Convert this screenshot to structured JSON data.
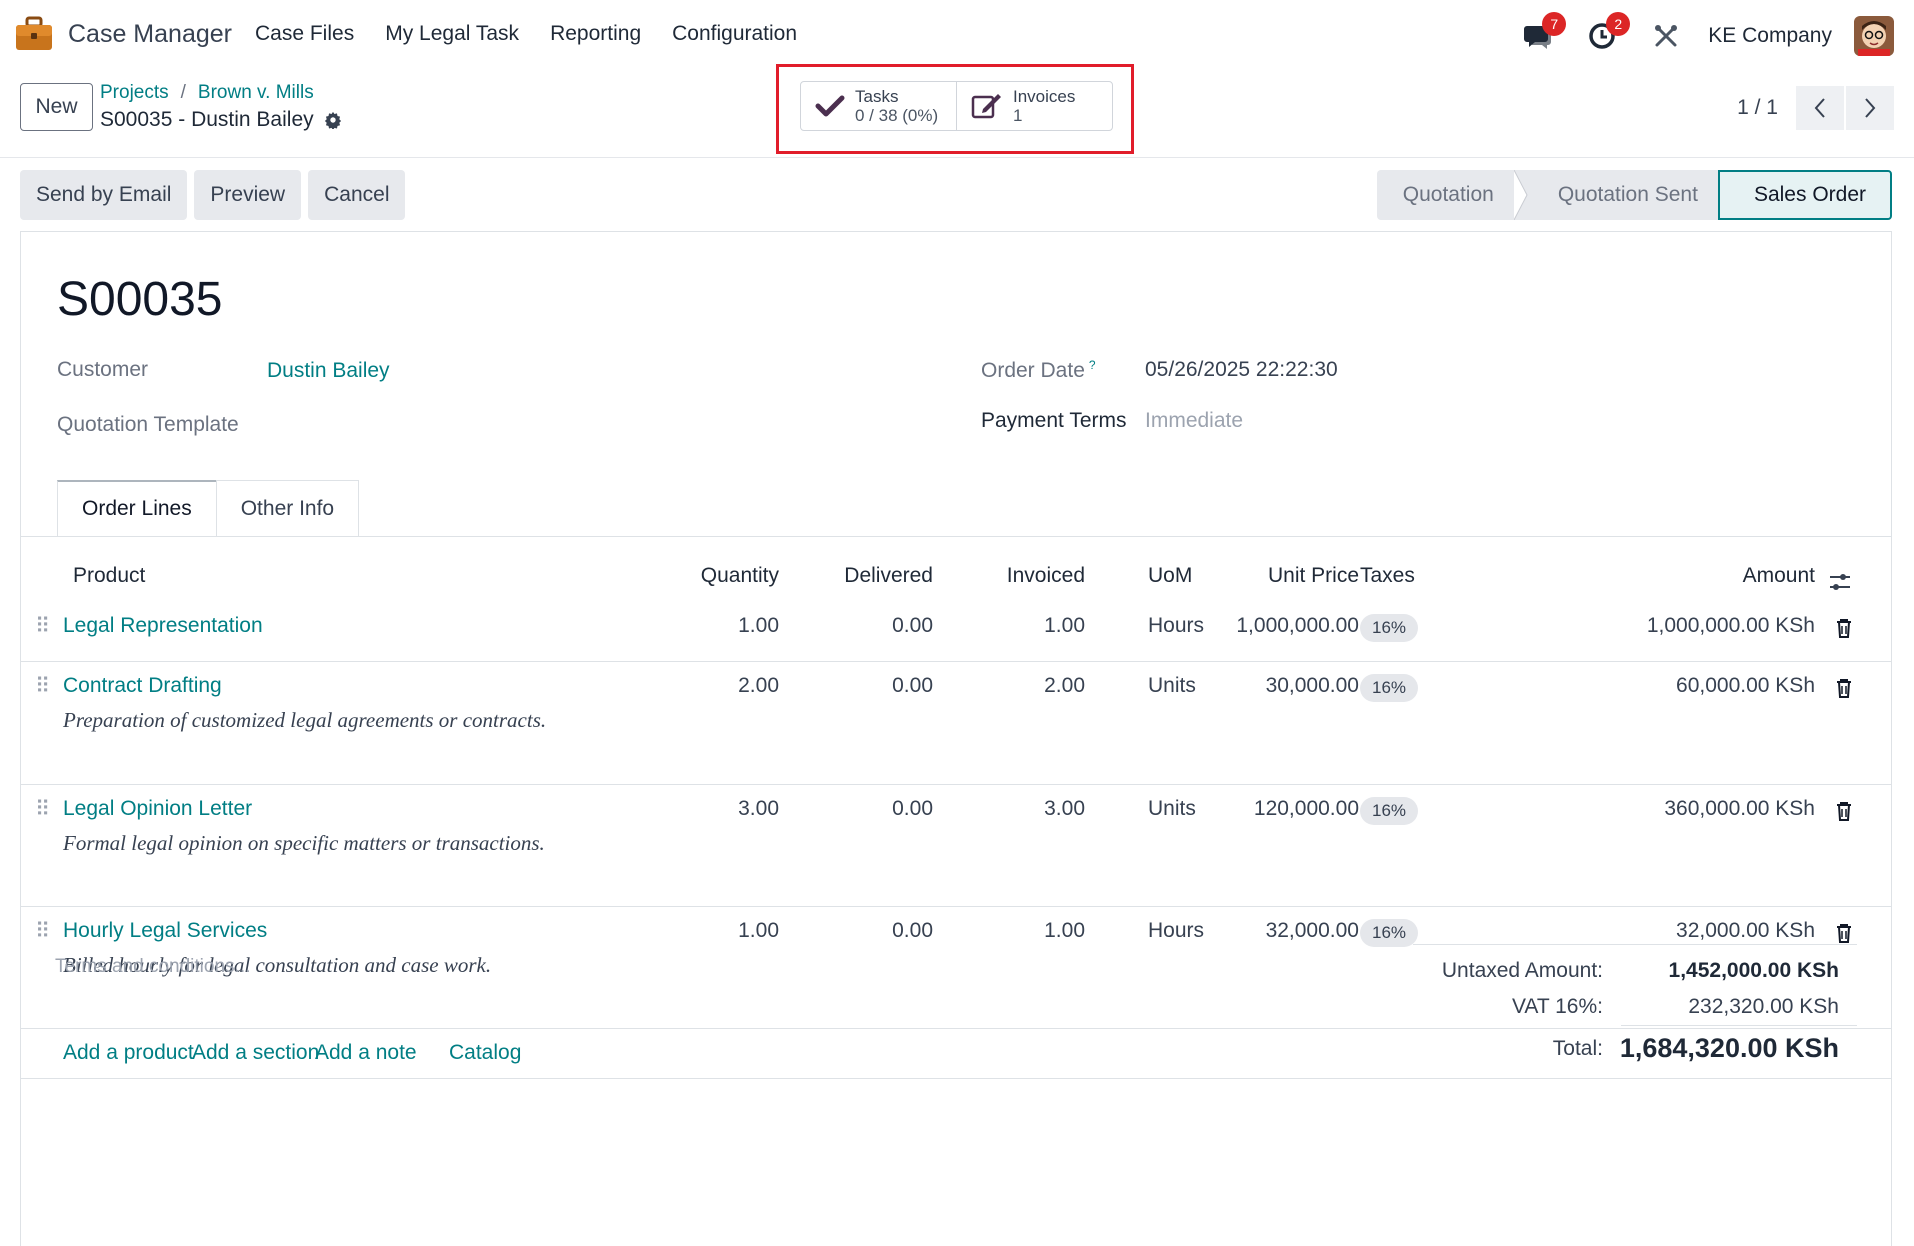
{
  "app": {
    "name": "Case Manager"
  },
  "menu": [
    "Case Files",
    "My Legal Task",
    "Reporting",
    "Configuration"
  ],
  "systray": {
    "messages_count": "7",
    "activities_count": "2",
    "company": "KE Company"
  },
  "control": {
    "new_label": "New",
    "breadcrumbs": [
      "Projects",
      "Brown v. Mills"
    ],
    "record_title": "S00035 - Dustin Bailey",
    "smart_buttons": [
      {
        "label": "Tasks",
        "value": "0 / 38 (0%)"
      },
      {
        "label": "Invoices",
        "value": "1"
      }
    ],
    "pager": "1 / 1"
  },
  "actions": [
    "Send by Email",
    "Preview",
    "Cancel"
  ],
  "stages": [
    "Quotation",
    "Quotation Sent",
    "Sales Order"
  ],
  "form": {
    "name": "S00035",
    "customer_label": "Customer",
    "customer_value": "Dustin Bailey",
    "template_label": "Quotation Template",
    "order_date_label": "Order Date",
    "order_date_help": "?",
    "order_date_value": "05/26/2025 22:22:30",
    "payment_terms_label": "Payment Terms",
    "payment_terms_value": "Immediate"
  },
  "tabs": [
    "Order Lines",
    "Other Info"
  ],
  "table": {
    "headers": {
      "product": "Product",
      "quantity": "Quantity",
      "delivered": "Delivered",
      "invoiced": "Invoiced",
      "uom": "UoM",
      "unit_price": "Unit Price",
      "taxes": "Taxes",
      "amount": "Amount"
    },
    "rows": [
      {
        "product": "Legal Representation",
        "description": "",
        "quantity": "1.00",
        "delivered": "0.00",
        "invoiced": "1.00",
        "uom": "Hours",
        "unit_price": "1,000,000.00",
        "tax": "16%",
        "amount": "1,000,000.00 KSh"
      },
      {
        "product": "Contract Drafting",
        "description": "Preparation of customized legal agreements or contracts.",
        "quantity": "2.00",
        "delivered": "0.00",
        "invoiced": "2.00",
        "uom": "Units",
        "unit_price": "30,000.00",
        "tax": "16%",
        "amount": "60,000.00 KSh"
      },
      {
        "product": "Legal Opinion Letter",
        "description": "Formal legal opinion on specific matters or transactions.",
        "quantity": "3.00",
        "delivered": "0.00",
        "invoiced": "3.00",
        "uom": "Units",
        "unit_price": "120,000.00",
        "tax": "16%",
        "amount": "360,000.00 KSh"
      },
      {
        "product": "Hourly Legal Services",
        "description": "Billed hourly for legal consultation and case work.",
        "quantity": "1.00",
        "delivered": "0.00",
        "invoiced": "1.00",
        "uom": "Hours",
        "unit_price": "32,000.00",
        "tax": "16%",
        "amount": "32,000.00 KSh"
      }
    ]
  },
  "add_links": [
    "Add a product",
    "Add a section",
    "Add a note",
    "Catalog"
  ],
  "terms_placeholder": "Terms and conditions...",
  "totals": {
    "untaxed_label": "Untaxed Amount:",
    "untaxed_value": "1,452,000.00 KSh",
    "vat_label": "VAT 16%:",
    "vat_value": "232,320.00 KSh",
    "total_label": "Total:",
    "total_value": "1,684,320.00 KSh"
  }
}
